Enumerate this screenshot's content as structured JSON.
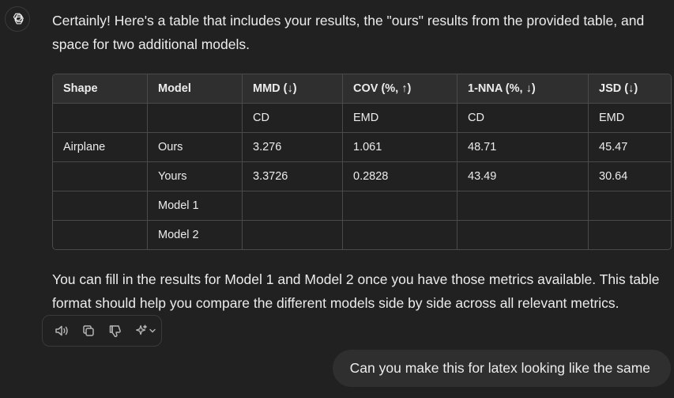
{
  "assistant": {
    "intro": "Certainly! Here's a table that includes your results, the \"ours\" results from the provided table, and space for two additional models.",
    "outro": "You can fill in the results for Model 1 and Model 2 once you have those metrics available. This table format should help you compare the different models side by side across all relevant metrics.",
    "table": {
      "headers": [
        "Shape",
        "Model",
        "MMD (↓)",
        "COV (%, ↑)",
        "1-NNA (%, ↓)",
        "JSD (↓)"
      ],
      "rows": [
        [
          "",
          "",
          "CD",
          "EMD",
          "CD",
          "EMD"
        ],
        [
          "Airplane",
          "Ours",
          "3.276",
          "1.061",
          "48.71",
          "45.47"
        ],
        [
          "",
          "Yours",
          "3.3726",
          "0.2828",
          "43.49",
          "30.64"
        ],
        [
          "",
          "Model 1",
          "",
          "",
          "",
          ""
        ],
        [
          "",
          "Model 2",
          "",
          "",
          "",
          ""
        ]
      ]
    }
  },
  "actions": {
    "icons": [
      "speaker-icon",
      "copy-icon",
      "thumbs-down-icon",
      "sparkle-icon"
    ]
  },
  "user": {
    "message": "Can you make this for latex looking like the same"
  }
}
